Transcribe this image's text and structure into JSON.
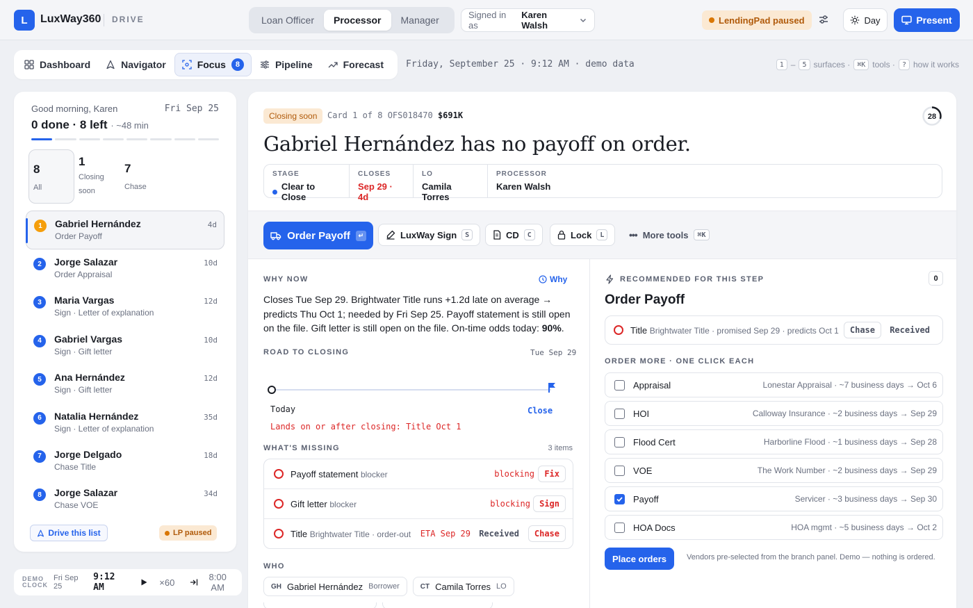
{
  "app": {
    "logo_letter": "L",
    "name": "LuxWay360",
    "section": "DRIVE"
  },
  "roles": [
    "Loan Officer",
    "Processor",
    "Manager"
  ],
  "signed_in": {
    "prefix": "Signed in as",
    "user": "Karen Walsh"
  },
  "lendingpad": "LendingPad paused",
  "theme": "Day",
  "present": "Present",
  "nav": {
    "items": [
      {
        "label": "Dashboard",
        "icon": "grid-icon"
      },
      {
        "label": "Navigator",
        "icon": "navigator-icon"
      },
      {
        "label": "Focus",
        "icon": "focus-icon",
        "badge": "8"
      },
      {
        "label": "Pipeline",
        "icon": "sliders-icon"
      },
      {
        "label": "Forecast",
        "icon": "trend-icon"
      }
    ],
    "date": "Friday, September 25 · 9:12 AM · demo data"
  },
  "shortcuts": {
    "k1": "1",
    "dash": "–",
    "k5": "5",
    "surfaces": "surfaces ·",
    "kcmd": "⌘K",
    "tools": "tools ·",
    "kq": "?",
    "how": "how it works"
  },
  "left": {
    "greeting": "Good morning, Karen",
    "date": "Fri Sep 25",
    "done": "0 done · 8 left",
    "eta": "· ~48 min",
    "segments_total": 8,
    "segments_done": 1,
    "tiles": [
      {
        "n": "8",
        "label": "All"
      },
      {
        "n": "1",
        "label": "Closing soon"
      },
      {
        "n": "7",
        "label": "Chase"
      }
    ],
    "queue": [
      {
        "num": "1",
        "name": "Gabriel Hernández",
        "task": "Order Payoff",
        "days": "4d"
      },
      {
        "num": "2",
        "name": "Jorge Salazar",
        "task": "Order Appraisal",
        "days": "10d"
      },
      {
        "num": "3",
        "name": "Maria Vargas",
        "task": "Sign · Letter of explanation",
        "days": "12d"
      },
      {
        "num": "4",
        "name": "Gabriel Vargas",
        "task": "Sign · Gift letter",
        "days": "10d"
      },
      {
        "num": "5",
        "name": "Ana Hernández",
        "task": "Sign · Gift letter",
        "days": "12d"
      },
      {
        "num": "6",
        "name": "Natalia Hernández",
        "task": "Sign · Letter of explanation",
        "days": "35d"
      },
      {
        "num": "7",
        "name": "Jorge Delgado",
        "task": "Chase Title",
        "days": "18d"
      },
      {
        "num": "8",
        "name": "Jorge Salazar",
        "task": "Chase VOE",
        "days": "34d"
      }
    ],
    "drive_btn": "Drive this list",
    "lp_paused": "LP paused"
  },
  "clock": {
    "label1": "DEMO",
    "label2": "CLOCK",
    "date": "Fri Sep 25",
    "time": "9:12 AM",
    "speed": "×60",
    "jump": "8:00 AM"
  },
  "card": {
    "badge": "Closing soon",
    "info_prefix": "Card 1 of 8 OFS018470",
    "amount": "$691K",
    "ring": "28",
    "ring_fraction": 0.3,
    "headline": "Gabriel Hernández has no payoff on order.",
    "facts": [
      {
        "k": "STAGE",
        "v": "Clear to Close"
      },
      {
        "k": "CLOSES",
        "v": "Sep 29 · 4d"
      },
      {
        "k": "LO",
        "v": "Camila Torres"
      },
      {
        "k": "PROCESSOR",
        "v": "Karen Walsh"
      }
    ]
  },
  "actions": {
    "primary": "Order Payoff",
    "sign": "LuxWay Sign",
    "sign_key": "S",
    "cd": "CD",
    "cd_key": "C",
    "lock": "Lock",
    "lock_key": "L",
    "more": "More tools",
    "more_key": "⌘K"
  },
  "whynow": {
    "title": "WHY NOW",
    "link": "Why",
    "text": "Closes Tue Sep 29. Brightwater Title runs +1.2d late on average → predicts Thu Oct 1; needed by Fri Sep 25. Payoff statement is still open on the file. Gift letter is still open on the file. On-time odds today:",
    "odds": "90%",
    "after": "."
  },
  "road": {
    "title": "ROAD TO CLOSING",
    "date": "Tue Sep 29",
    "today": "Today",
    "close": "Close",
    "note": "Lands on or after closing: Title Oct 1"
  },
  "missing": {
    "title": "WHAT'S MISSING",
    "count": "3 items",
    "items": [
      {
        "label": "Payoff statement",
        "tag": "blocker",
        "status": "blocking",
        "action": "Fix"
      },
      {
        "label": "Gift letter",
        "tag": "blocker",
        "status": "blocking",
        "action": "Sign"
      },
      {
        "label": "Title",
        "tag": "Brightwater Title · order-out",
        "status": "ETA Sep 29",
        "extra": "Received",
        "action": "Chase"
      }
    ]
  },
  "who": {
    "title": "WHO",
    "people": [
      {
        "ini": "GH",
        "name": "Gabriel Hernández",
        "role": "Borrower"
      },
      {
        "ini": "CT",
        "name": "Camila Torres",
        "role": "LO"
      }
    ]
  },
  "rec": {
    "title": "RECOMMENDED FOR THIS STEP",
    "count": "0",
    "heading": "Order Payoff",
    "title_row": {
      "label": "Title",
      "detail": "Brightwater Title · promised Sep 29 · predicts Oct 1",
      "chase": "Chase",
      "received": "Received"
    },
    "order_more": "ORDER MORE · ONE CLICK EACH",
    "orders": [
      {
        "name": "Appraisal",
        "vendor": "Lonestar Appraisal · ~7 business days → Oct 6",
        "checked": false
      },
      {
        "name": "HOI",
        "vendor": "Calloway Insurance · ~2 business days → Sep 29",
        "checked": false
      },
      {
        "name": "Flood Cert",
        "vendor": "Harborline Flood · ~1 business days → Sep 28",
        "checked": false
      },
      {
        "name": "VOE",
        "vendor": "The Work Number · ~2 business days → Sep 29",
        "checked": false
      },
      {
        "name": "Payoff",
        "vendor": "Servicer · ~3 business days → Sep 30",
        "checked": true
      },
      {
        "name": "HOA Docs",
        "vendor": "HOA mgmt · ~5 business days → Oct 2",
        "checked": false
      }
    ],
    "place": "Place orders",
    "note": "Vendors pre-selected from the branch panel. Demo — nothing is ordered."
  },
  "colors": {
    "accent": "#2563eb",
    "danger": "#dc2626",
    "warn": "#d97706"
  }
}
